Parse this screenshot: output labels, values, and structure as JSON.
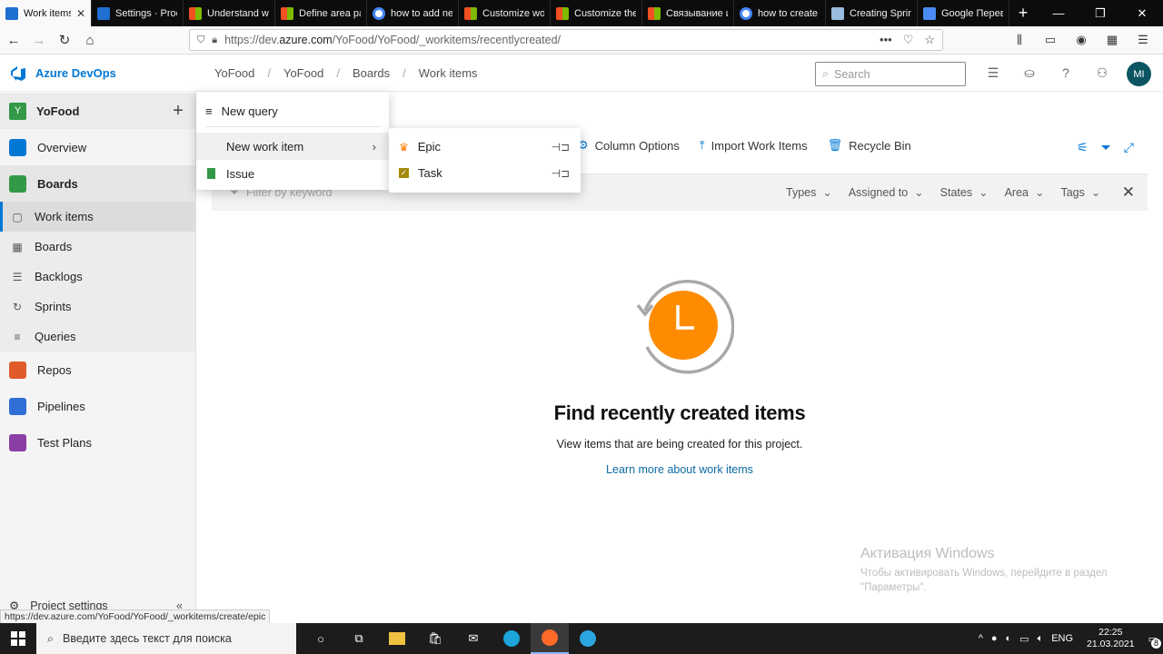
{
  "browser": {
    "tabs": [
      {
        "title": "Work items",
        "favicon": "azure-devops",
        "active": true
      },
      {
        "title": "Settings · Proc",
        "favicon": "azure-devops",
        "active": false
      },
      {
        "title": "Understand wh",
        "favicon": "microsoft",
        "active": false
      },
      {
        "title": "Define area pa",
        "favicon": "microsoft",
        "active": false
      },
      {
        "title": "how to add ne",
        "favicon": "google",
        "active": false
      },
      {
        "title": "Customize wo",
        "favicon": "microsoft",
        "active": false
      },
      {
        "title": "Customize the",
        "favicon": "microsoft",
        "active": false
      },
      {
        "title": "Связывание и",
        "favicon": "microsoft",
        "active": false
      },
      {
        "title": "how to create",
        "favicon": "google",
        "active": false
      },
      {
        "title": "Creating Sprin",
        "favicon": "doc",
        "active": false
      },
      {
        "title": "Google Перев",
        "favicon": "translate",
        "active": false
      }
    ],
    "url_prefix": "https://dev.",
    "url_domain": "azure.com",
    "url_suffix": "/YoFood/YoFood/_workitems/recentlycreated/",
    "status_url": "https://dev.azure.com/YoFood/YoFood/_workitems/create/epic"
  },
  "header": {
    "brand": "Azure DevOps",
    "breadcrumb": [
      "YoFood",
      "YoFood",
      "Boards",
      "Work items"
    ],
    "search_placeholder": "Search",
    "avatar_initials": "MI"
  },
  "sidebar": {
    "project_initial": "Y",
    "project_name": "YoFood",
    "items": [
      {
        "label": "Overview"
      },
      {
        "label": "Boards"
      },
      {
        "label": "Work items"
      },
      {
        "label": "Boards"
      },
      {
        "label": "Backlogs"
      },
      {
        "label": "Sprints"
      },
      {
        "label": "Queries"
      },
      {
        "label": "Repos"
      },
      {
        "label": "Pipelines"
      },
      {
        "label": "Test Plans"
      }
    ],
    "project_settings": "Project settings"
  },
  "toolbar": {
    "column_options": "Column Options",
    "import_work_items": "Import Work Items",
    "recycle_bin": "Recycle Bin"
  },
  "filterbar": {
    "keyword_placeholder": "Filter by keyword",
    "filters": [
      "Types",
      "Assigned to",
      "States",
      "Area",
      "Tags"
    ]
  },
  "menu": {
    "new_query": "New query",
    "new_work_item": "New work item",
    "issue": "Issue"
  },
  "submenu": {
    "items": [
      {
        "label": "Epic",
        "color": "#ff7b00"
      },
      {
        "label": "Task",
        "color": "#a4880a"
      }
    ]
  },
  "empty_state": {
    "title": "Find recently created items",
    "subtitle": "View items that are being created for this project.",
    "link": "Learn more about work items"
  },
  "watermark": {
    "title": "Активация Windows",
    "line1": "Чтобы активировать Windows, перейдите в раздел",
    "line2": "\"Параметры\"."
  },
  "taskbar": {
    "search_placeholder": "Введите здесь текст для поиска",
    "language": "ENG",
    "time": "22:25",
    "date": "21.03.2021",
    "notification_count": "8"
  },
  "colors": {
    "accent": "#0078d4",
    "brand_text": "#0078d4",
    "clock_orange": "#ff8c00"
  }
}
